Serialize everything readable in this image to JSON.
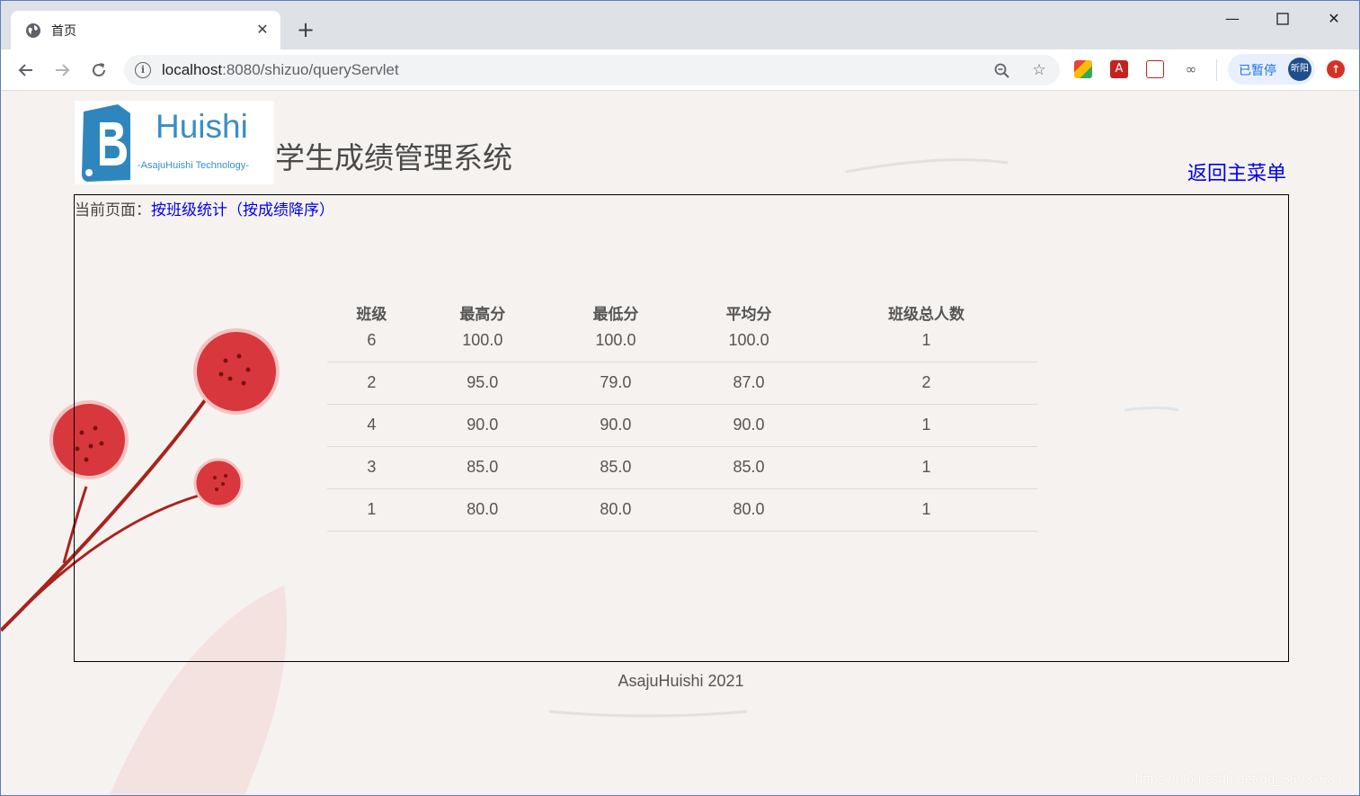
{
  "browser": {
    "tab_title": "首页",
    "url_host": "localhost",
    "url_rest": ":8080/shizuo/queryServlet",
    "profile_status": "已暂停",
    "profile_name": "昕阳"
  },
  "header": {
    "logo_text": "Huishi",
    "logo_subtext": "-AsajuHuishi Technology-",
    "site_title": "学生成绩管理系统",
    "back_link": "返回主菜单"
  },
  "breadcrumb": {
    "label": "当前页面：",
    "current": "按班级统计（按成绩降序）"
  },
  "table": {
    "headers": [
      "班级",
      "最高分",
      "最低分",
      "平均分",
      "班级总人数"
    ],
    "rows": [
      [
        "6",
        "100.0",
        "100.0",
        "100.0",
        "1"
      ],
      [
        "2",
        "95.0",
        "79.0",
        "87.0",
        "2"
      ],
      [
        "4",
        "90.0",
        "90.0",
        "90.0",
        "1"
      ],
      [
        "3",
        "85.0",
        "85.0",
        "85.0",
        "1"
      ],
      [
        "1",
        "80.0",
        "80.0",
        "80.0",
        "1"
      ]
    ]
  },
  "footer": {
    "text": "AsajuHuishi 2021",
    "watermark": "https://blog.csdn.net/qq_36937684"
  }
}
